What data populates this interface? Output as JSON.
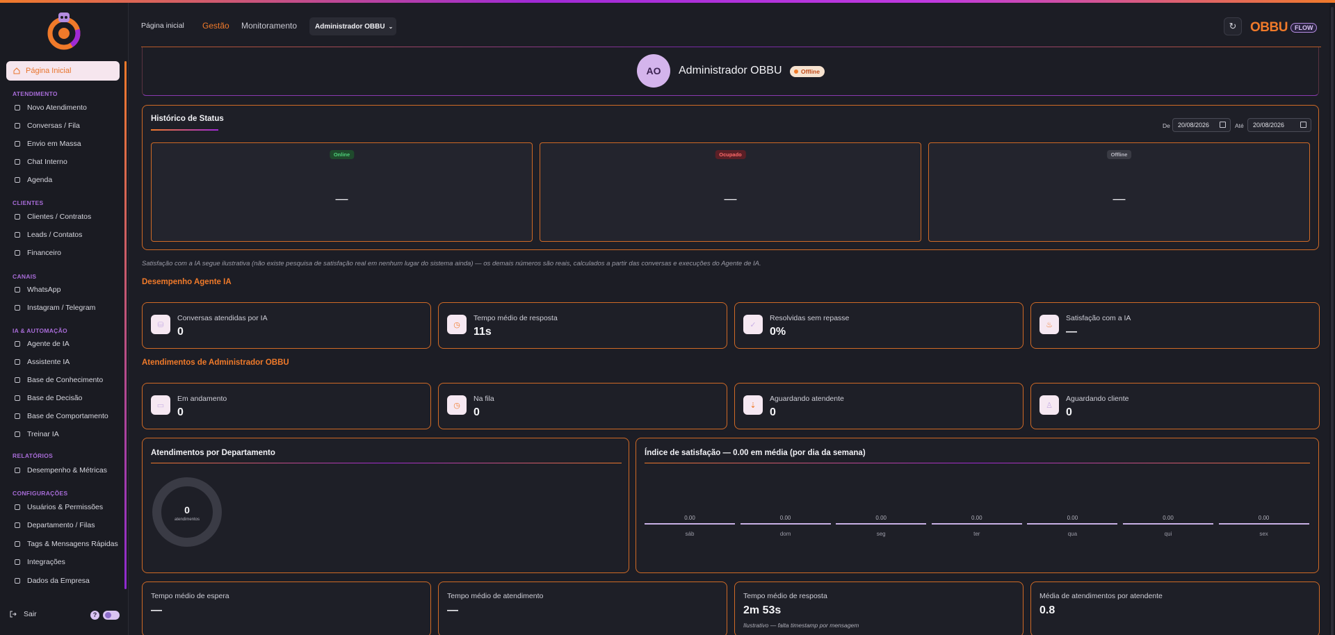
{
  "sidebar": {
    "home": "Página Inicial",
    "sections": [
      {
        "title": "ATENDIMENTO",
        "items": [
          {
            "label": "Novo Atendimento",
            "icon": "chat-icon"
          },
          {
            "label": "Conversas / Fila",
            "icon": "inbox-icon"
          },
          {
            "label": "Envio em Massa",
            "icon": "list-icon"
          },
          {
            "label": "Chat Interno",
            "icon": "chat-icon"
          },
          {
            "label": "Agenda",
            "icon": "calendar-icon"
          }
        ]
      },
      {
        "title": "CLIENTES",
        "items": [
          {
            "label": "Clientes / Contratos",
            "icon": "user-icon"
          },
          {
            "label": "Leads / Contatos",
            "icon": "user-plus-icon"
          },
          {
            "label": "Financeiro",
            "icon": "dollar-icon"
          }
        ]
      },
      {
        "title": "CANAIS",
        "items": [
          {
            "label": "WhatsApp",
            "icon": "whatsapp-icon"
          },
          {
            "label": "Instagram / Telegram",
            "icon": "instagram-icon"
          }
        ]
      },
      {
        "title": "IA & AUTOMAÇÃO",
        "items": [
          {
            "label": "Agente de IA",
            "icon": "document-icon"
          },
          {
            "label": "Assistente IA",
            "icon": "chat-icon"
          },
          {
            "label": "Base de Conhecimento",
            "icon": "book-icon"
          },
          {
            "label": "Base de Decisão",
            "icon": "target-icon"
          },
          {
            "label": "Base de Comportamento",
            "icon": "user-icon"
          },
          {
            "label": "Treinar IA",
            "icon": "document-icon"
          }
        ]
      },
      {
        "title": "RELATÓRIOS",
        "items": [
          {
            "label": "Desempenho & Métricas",
            "icon": "bar-chart-icon"
          }
        ]
      },
      {
        "title": "CONFIGURAÇÕES",
        "items": [
          {
            "label": "Usuários & Permissões",
            "icon": "users-icon"
          },
          {
            "label": "Departamento / Filas",
            "icon": "building-icon"
          },
          {
            "label": "Tags & Mensagens Rápidas",
            "icon": "tag-icon"
          },
          {
            "label": "Integrações",
            "icon": "plug-icon"
          },
          {
            "label": "Dados da Empresa",
            "icon": "document-icon"
          }
        ]
      }
    ],
    "logout": "Sair",
    "help": "?"
  },
  "header": {
    "home": "Página inicial",
    "tab_gestao": "Gestão",
    "tab_monitoramento": "Monitoramento",
    "selected_user": "Administrador OBBU",
    "brand_name": "OBBU",
    "brand_tag": "FLOW"
  },
  "profile": {
    "initials": "AO",
    "name": "Administrador OBBU",
    "status": "Offline"
  },
  "status_history": {
    "title": "Histórico de Status",
    "from_label": "De",
    "from_value": "20/08/2026",
    "to_label": "Até",
    "to_value": "20/08/2026",
    "boxes": [
      {
        "label": "Online",
        "value": "—",
        "bg": "#1f4a2c",
        "fg": "#4fd07a"
      },
      {
        "label": "Ocupado",
        "value": "—",
        "bg": "#5a1f26",
        "fg": "#ff6a6a"
      },
      {
        "label": "Offline",
        "value": "—",
        "bg": "#3a3b44",
        "fg": "#b8b8c2"
      }
    ]
  },
  "note": "Satisfação com a IA segue ilustrativa (não existe pesquisa de satisfação real em nenhum lugar do sistema ainda) — os demais números são reais, calculados a partir das conversas e execuções do Agente de IA.",
  "ai_performance": {
    "title": "Desempenho Agente IA",
    "cards": [
      {
        "label": "Conversas atendidas por IA",
        "value": "0",
        "icon": "database-icon"
      },
      {
        "label": "Tempo médio de resposta",
        "value": "11s",
        "icon": "clock-icon"
      },
      {
        "label": "Resolvidas sem repasse",
        "value": "0%",
        "icon": "check-icon"
      },
      {
        "label": "Satisfação com a IA",
        "value": "—",
        "icon": "flame-icon"
      }
    ]
  },
  "attendances": {
    "title": "Atendimentos de Administrador OBBU",
    "cards": [
      {
        "label": "Em andamento",
        "value": "0",
        "icon": "chat-icon"
      },
      {
        "label": "Na fila",
        "value": "0",
        "icon": "clock-icon"
      },
      {
        "label": "Aguardando atendente",
        "value": "0",
        "icon": "download-icon"
      },
      {
        "label": "Aguardando cliente",
        "value": "0",
        "icon": "user-icon"
      }
    ]
  },
  "dept": {
    "title": "Atendimentos por Departamento",
    "total": "0",
    "total_label": "atendimentos"
  },
  "satisfaction": {
    "title": "Índice de satisfação — 0.00 em média (por dia da semana)"
  },
  "chart_data": {
    "type": "bar",
    "title": "Índice de satisfação — 0.00 em média (por dia da semana)",
    "categories": [
      "sáb",
      "dom",
      "seg",
      "ter",
      "qua",
      "qui",
      "sex"
    ],
    "values": [
      0.0,
      0.0,
      0.0,
      0.0,
      0.0,
      0.0,
      0.0
    ],
    "value_labels": [
      "0.00",
      "0.00",
      "0.00",
      "0.00",
      "0.00",
      "0.00",
      "0.00"
    ]
  },
  "bottom_cards": [
    {
      "label": "Tempo médio de espera",
      "value": "—",
      "note": ""
    },
    {
      "label": "Tempo médio de atendimento",
      "value": "—",
      "note": ""
    },
    {
      "label": "Tempo médio de resposta",
      "value": "2m 53s",
      "note": "Ilustrativo — falta timestamp por mensagem"
    },
    {
      "label": "Média de atendimentos por atendente",
      "value": "0.8",
      "note": ""
    }
  ],
  "colors": {
    "accent": "#f07a2a",
    "purple": "#a02ad6"
  }
}
